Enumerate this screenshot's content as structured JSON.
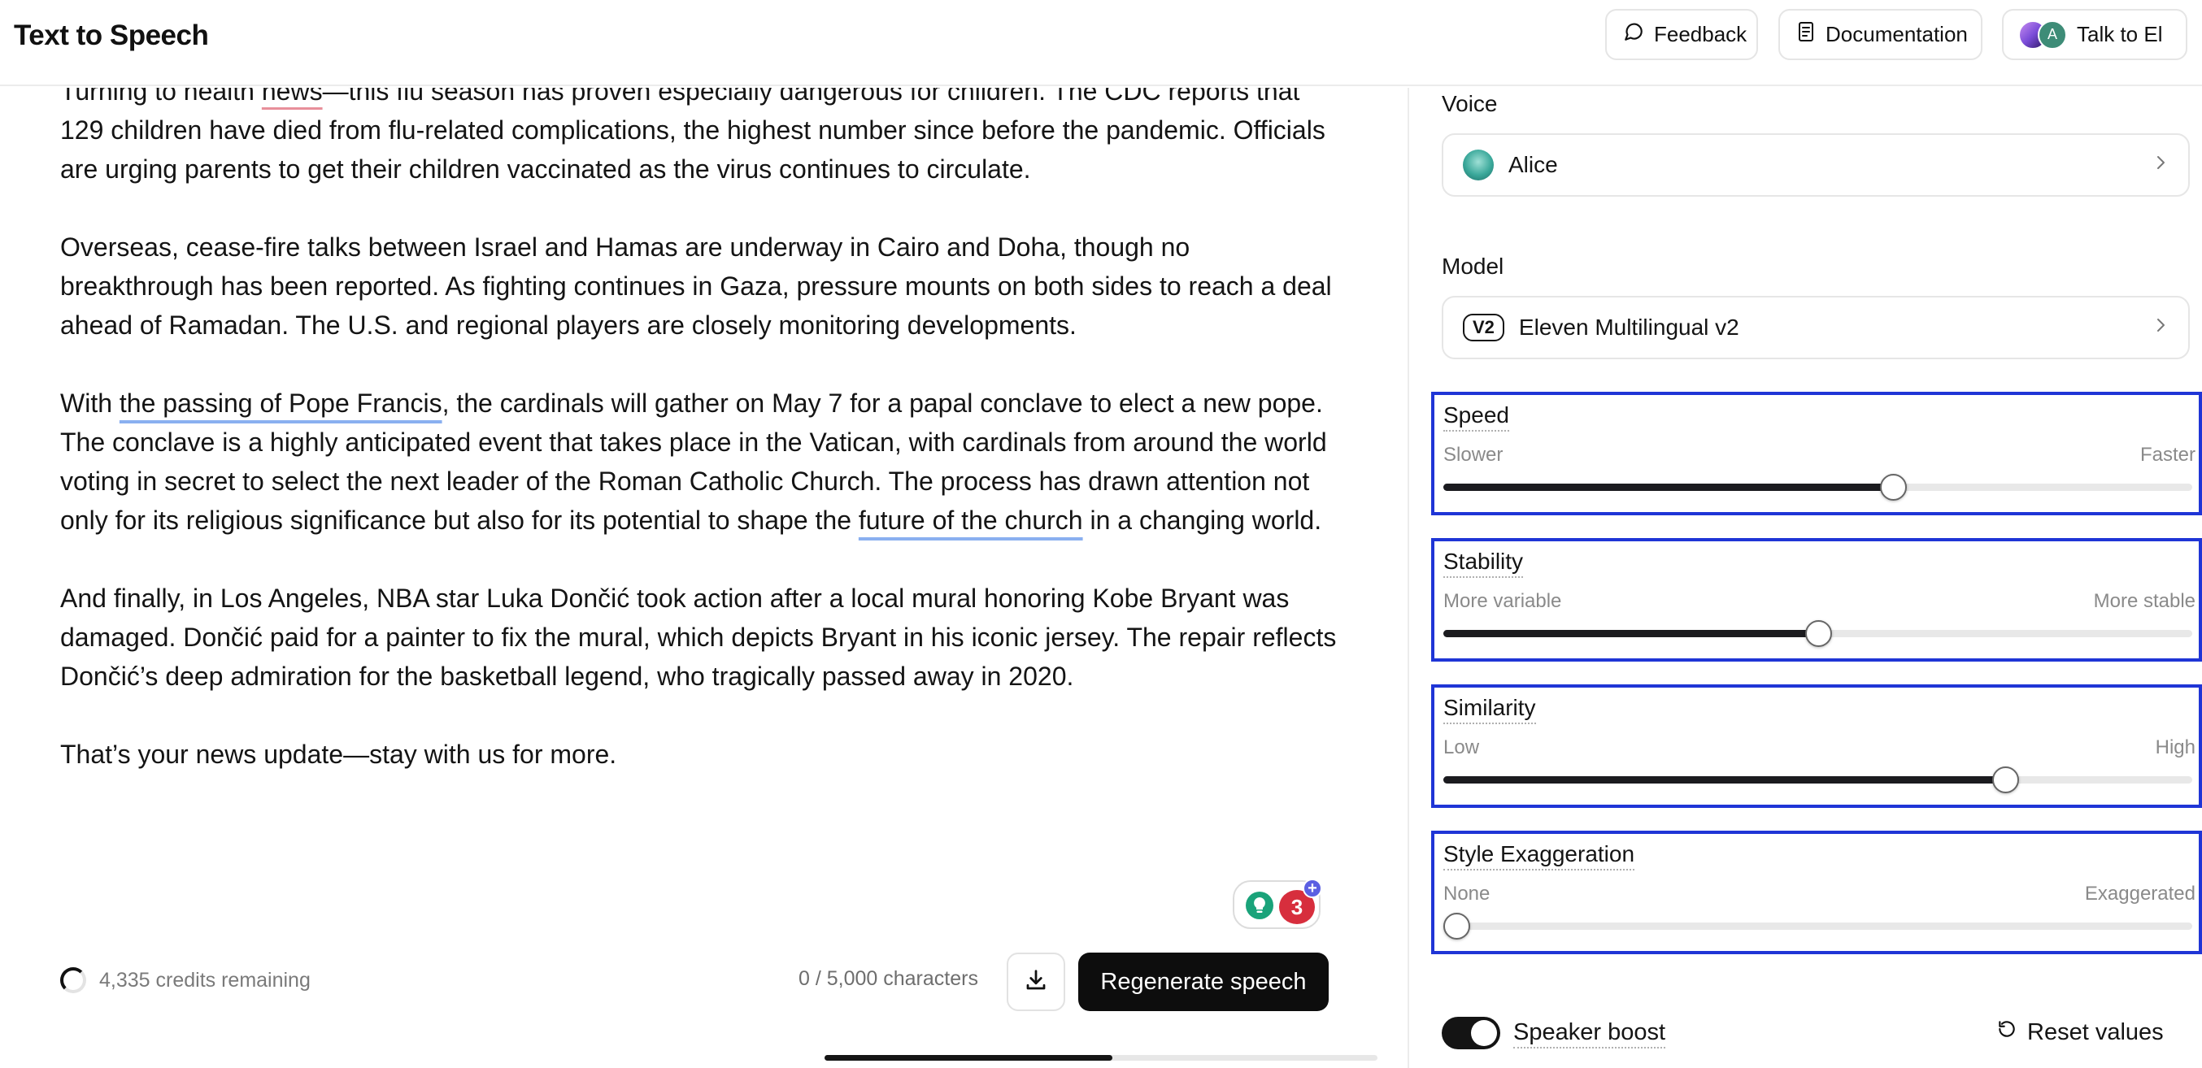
{
  "header": {
    "title": "Text to Speech",
    "feedback_label": "Feedback",
    "docs_label": "Documentation",
    "talk_label": "Talk to El",
    "avatar_initial": "A"
  },
  "editor": {
    "p1": {
      "pre": "Turning to health ",
      "flag": "news",
      "post": "—this flu season has proven especially dangerous for children. The CDC reports that 129 children have died from flu-related complications, the highest number since before the pandemic. Officials are urging parents to get their children vaccinated as the virus continues to circulate."
    },
    "p2": "Overseas, cease-fire talks between Israel and Hamas are underway in Cairo and Doha, though no breakthrough has been reported. As fighting continues in Gaza, pressure mounts on both sides to reach a deal ahead of Ramadan. The U.S. and regional players are closely monitoring developments.",
    "p3": {
      "pre": "With ",
      "link1": "the passing of Pope Francis",
      "mid": ", the cardinals will gather on May 7 for a papal conclave to elect a new pope. The conclave is a highly anticipated event that takes place in the Vatican, with cardinals from around the world voting in secret to select the next leader of the Roman Catholic Church. The process has drawn attention not only for its religious significance but also for its potential to shape the ",
      "link2": "future of the church",
      "post": " in a changing world."
    },
    "p4": "And finally, in Los Angeles, NBA star Luka Dončić took action after a local mural honoring Kobe Bryant was damaged. Dončić paid for a painter to fix the mural, which depicts Bryant in his iconic jersey. The repair reflects Dončić’s deep admiration for the basketball legend, who tragically passed away in 2020.",
    "p5": "That’s your news update—stay with us for more.",
    "grammar_count": "3",
    "grammar_plus": "+"
  },
  "footer": {
    "credits": "4,335 credits remaining",
    "char_count": "0 / 5,000 characters",
    "regenerate_label": "Regenerate speech",
    "scroll_fraction": 0.52
  },
  "settings": {
    "voice_label": "Voice",
    "voice_value": "Alice",
    "model_label": "Model",
    "model_badge": "V2",
    "model_value": "Eleven Multilingual v2",
    "sliders": [
      {
        "title": "Speed",
        "left": "Slower",
        "right": "Faster",
        "value": 0.6
      },
      {
        "title": "Stability",
        "left": "More variable",
        "right": "More stable",
        "value": 0.5
      },
      {
        "title": "Similarity",
        "left": "Low",
        "right": "High",
        "value": 0.75
      },
      {
        "title": "Style Exaggeration",
        "left": "None",
        "right": "Exaggerated",
        "value": 0.0
      }
    ],
    "speaker_boost_label": "Speaker boost",
    "speaker_boost_on": true,
    "reset_label": "Reset values"
  },
  "colors": {
    "highlight_box": "#1f35d6",
    "primary_button": "#0d0d0d"
  }
}
